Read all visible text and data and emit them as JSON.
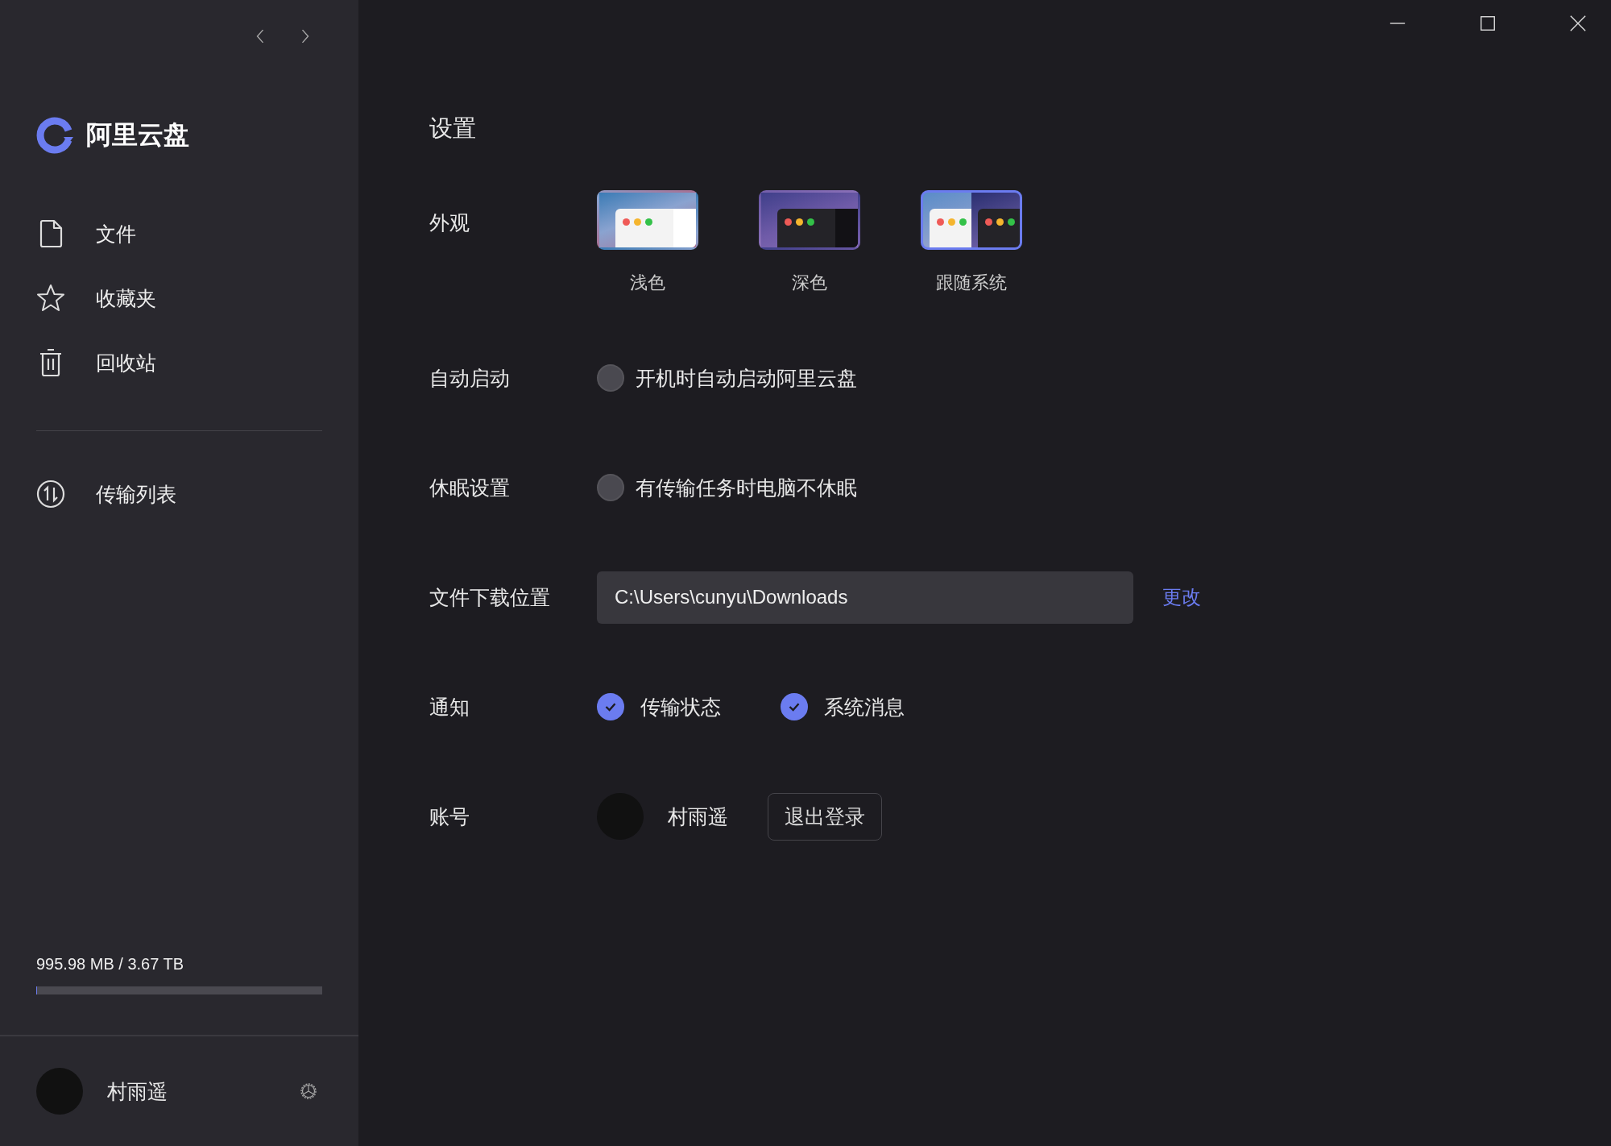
{
  "sidebar": {
    "logo_text": "阿里云盘",
    "items": [
      {
        "kind": "file",
        "label": "文件",
        "selected": false
      },
      {
        "kind": "star",
        "label": "收藏夹",
        "selected": false
      },
      {
        "kind": "trash",
        "label": "回收站",
        "selected": false
      }
    ],
    "transfer_item": {
      "label": "传输列表",
      "selected": false
    },
    "storage": {
      "text": "995.98 MB / 3.67 TB",
      "level": 0.0003
    },
    "user": {
      "name": "村雨遥"
    }
  },
  "settings": {
    "title": "设置",
    "appearance": {
      "label": "外观",
      "themes": [
        {
          "kind": "light",
          "label": "浅色",
          "selected": false
        },
        {
          "kind": "dark",
          "label": "深色",
          "selected": false
        },
        {
          "kind": "system",
          "label": "跟随系统",
          "selected": true
        }
      ]
    },
    "autostart": {
      "label": "自动启动",
      "option": "开机时自动启动阿里云盘",
      "checked": false
    },
    "sleep": {
      "label": "休眠设置",
      "option": "有传输任务时电脑不休眠",
      "checked": false
    },
    "download": {
      "label": "文件下载位置",
      "value": "C:\\Users\\cunyu\\Downloads",
      "action": "更改"
    },
    "notify": {
      "label": "通知",
      "options": [
        {
          "label": "传输状态",
          "checked": true
        },
        {
          "label": "系统消息",
          "checked": true
        }
      ]
    },
    "account": {
      "label": "账号",
      "name": "村雨遥",
      "logout": "退出登录"
    }
  }
}
